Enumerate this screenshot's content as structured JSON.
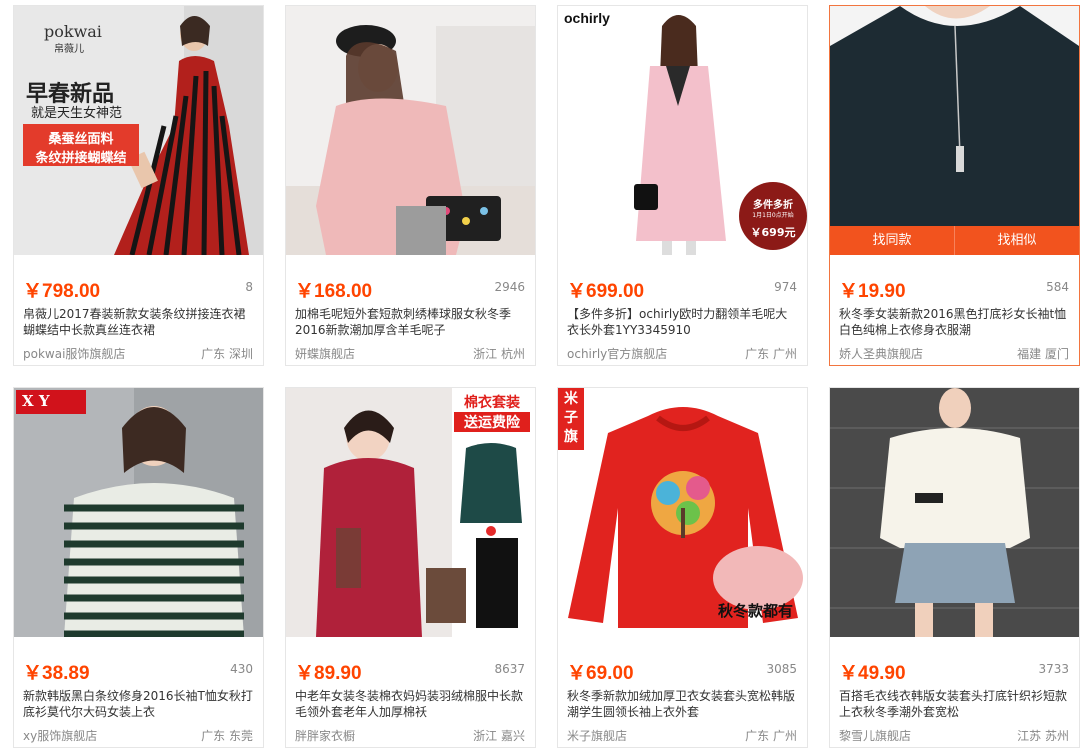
{
  "products": [
    {
      "price": "￥798.00",
      "sales": "8",
      "title": "帛薇儿2017春装新款女装条纹拼接连衣裙蝴蝶结中长款真丝连衣裙",
      "shop": "pokwai服饰旗舰店",
      "location": "广东 深圳",
      "overlay": {
        "brand": "pokwai",
        "brand_cn": "帛薇儿",
        "headline": "早春新品",
        "sub": "就是天生女神范",
        "box_line1": "桑蚕丝面料",
        "box_line2": "条纹拼接蝴蝶结"
      }
    },
    {
      "price": "￥168.00",
      "sales": "2946",
      "title": "加棉毛呢短外套短款刺绣棒球服女秋冬季2016新款潮加厚含羊毛呢子",
      "shop": "妍蝶旗舰店",
      "location": "浙江 杭州"
    },
    {
      "price": "￥699.00",
      "sales": "974",
      "title": "【多件多折】ochirly欧时力翻领羊毛呢大衣长外套1YY3345910",
      "shop": "ochirly官方旗舰店",
      "location": "广东 广州",
      "overlay": {
        "brand": "ochirly",
        "badge_line1": "多件多折",
        "badge_line2": "1月1日0点开始",
        "badge_price": "￥699元"
      }
    },
    {
      "price": "￥19.90",
      "sales": "584",
      "title": "秋冬季女装新款2016黑色打底衫女长袖t恤白色纯棉上衣修身衣服潮",
      "shop": "娇人圣典旗舰店",
      "location": "福建 厦门",
      "tabs": [
        "找同款",
        "找相似"
      ]
    },
    {
      "price": "￥38.89",
      "sales": "430",
      "title": "新款韩版黑白条纹修身2016长袖T恤女秋打底衫莫代尔大码女装上衣",
      "shop": "xy服饰旗舰店",
      "location": "广东 东莞",
      "overlay": {
        "brand": "X Y"
      }
    },
    {
      "price": "￥89.90",
      "sales": "8637",
      "title": "中老年女装冬装棉衣妈妈装羽绒棉服中长款毛领外套老年人加厚棉袄",
      "shop": "胖胖家衣橱",
      "location": "浙江 嘉兴",
      "overlay": {
        "line1": "棉衣套装",
        "line2": "送运费险"
      }
    },
    {
      "price": "￥69.00",
      "sales": "3085",
      "title": "秋冬季新款加绒加厚卫衣女装套头宽松韩版潮学生圆领长袖上衣外套",
      "shop": "米子旗舰店",
      "location": "广东 广州",
      "overlay": {
        "brand": "米子旗",
        "caption": "秋冬款都有"
      }
    },
    {
      "price": "￥49.90",
      "sales": "3733",
      "title": "百搭毛衣线衣韩版女装套头打底针织衫短款上衣秋冬季潮外套宽松",
      "shop": "黎雪儿旗舰店",
      "location": "江苏 苏州"
    }
  ]
}
